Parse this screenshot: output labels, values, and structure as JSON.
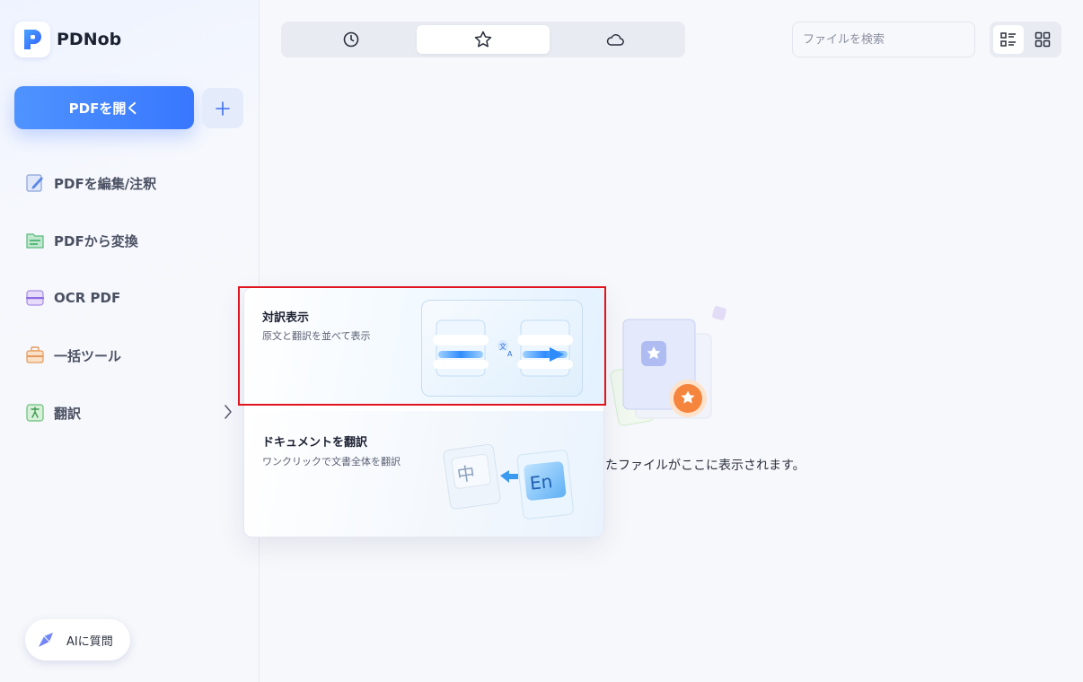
{
  "app": {
    "name": "PDNob"
  },
  "sidebar": {
    "open_button": "PDFを開く",
    "items": [
      {
        "label": "PDFを編集/注釈",
        "icon": "edit-icon"
      },
      {
        "label": "PDFから変換",
        "icon": "convert-icon"
      },
      {
        "label": "OCR PDF",
        "icon": "ocr-icon"
      },
      {
        "label": "一括ツール",
        "icon": "toolbox-icon"
      },
      {
        "label": "翻訳",
        "icon": "translate-icon"
      }
    ],
    "ai_button": "AIに質問"
  },
  "topbar": {
    "tabs": [
      {
        "icon": "clock-icon",
        "active": false
      },
      {
        "icon": "star-icon",
        "active": true
      },
      {
        "icon": "cloud-icon",
        "active": false
      }
    ],
    "search_placeholder": "ファイルを検索",
    "view_modes": [
      {
        "icon": "list-view-icon",
        "active": true
      },
      {
        "icon": "grid-view-icon",
        "active": false
      }
    ]
  },
  "main": {
    "empty_text": "たファイルがここに表示されます。"
  },
  "translate_menu": {
    "options": [
      {
        "title": "対訳表示",
        "subtitle": "原文と翻訳を並べて表示"
      },
      {
        "title": "ドキュメントを翻訳",
        "subtitle": "ワンクリックで文書全体を翻訳"
      }
    ],
    "illustration_labels": [
      "中",
      "En"
    ]
  },
  "colors": {
    "accent": "#3a7cff",
    "highlight_border": "#e0141e",
    "badge_orange": "#f5843c"
  }
}
